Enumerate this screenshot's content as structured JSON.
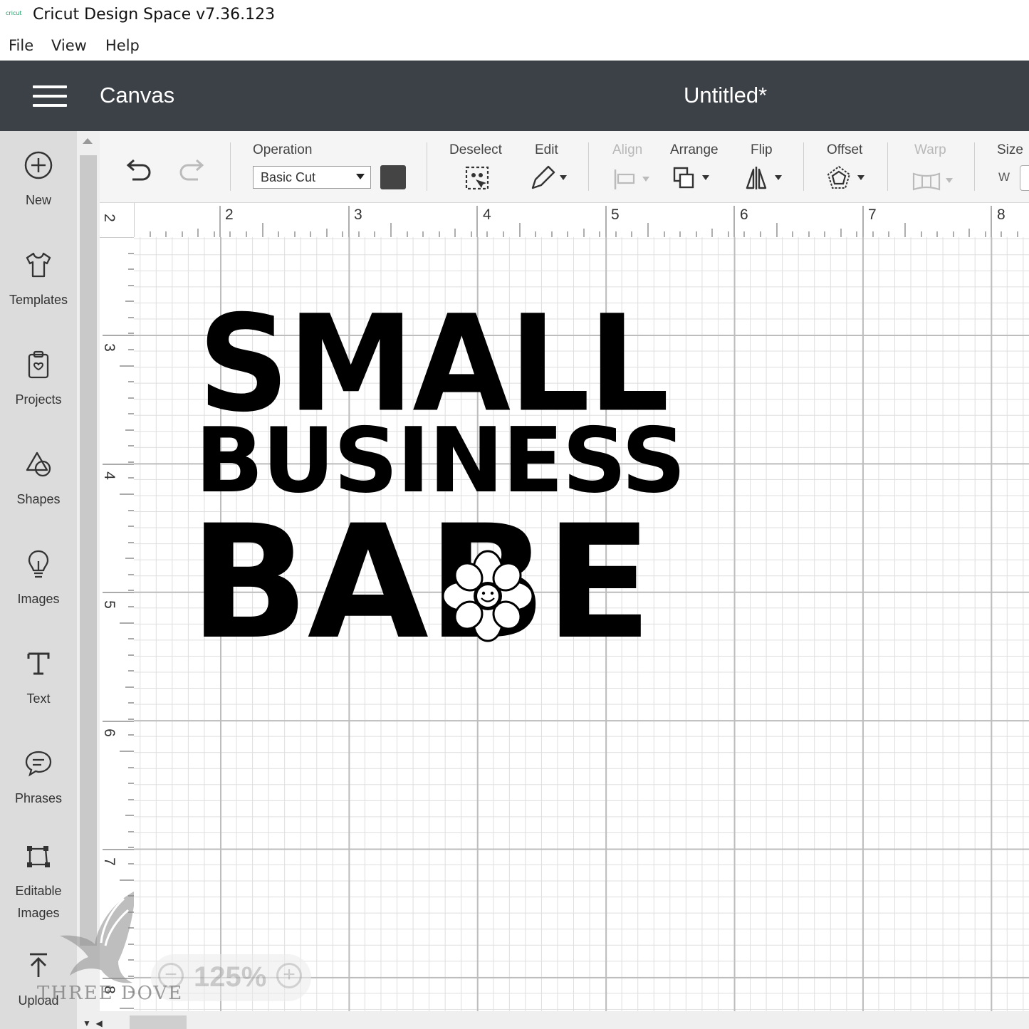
{
  "window": {
    "logo_text": "cricut",
    "title": "Cricut Design Space  v7.36.123"
  },
  "menu": [
    "File",
    "View",
    "Help"
  ],
  "header": {
    "section": "Canvas",
    "document": "Untitled*"
  },
  "sidebar": {
    "items": [
      {
        "label": "New",
        "icon": "plus-circle-icon"
      },
      {
        "label": "Templates",
        "icon": "tshirt-icon"
      },
      {
        "label": "Projects",
        "icon": "clipboard-icon"
      },
      {
        "label": "Shapes",
        "icon": "shapes-icon"
      },
      {
        "label": "Images",
        "icon": "lightbulb-icon"
      },
      {
        "label": "Text",
        "icon": "text-t-icon"
      },
      {
        "label": "Phrases",
        "icon": "speech-bubble-icon"
      },
      {
        "label": "Editable Images",
        "icon": "editable-image-icon"
      },
      {
        "label": "Upload",
        "icon": "upload-icon"
      }
    ]
  },
  "toolbar": {
    "operation_label": "Operation",
    "operation_value": "Basic Cut",
    "operation_color": "#444444",
    "deselect_label": "Deselect",
    "edit_label": "Edit",
    "align_label": "Align",
    "arrange_label": "Arrange",
    "flip_label": "Flip",
    "offset_label": "Offset",
    "warp_label": "Warp",
    "size_label": "Size",
    "size_w_label": "W"
  },
  "rulers": {
    "horizontal": [
      "2",
      "2",
      "3",
      "4",
      "5",
      "6",
      "7",
      "8"
    ],
    "vertical": [
      "3",
      "4",
      "5",
      "6",
      "7",
      "8"
    ]
  },
  "artwork": {
    "line1": "SMALL",
    "line2": "BUSINESS",
    "line3": "BABE"
  },
  "zoom": {
    "minus": "−",
    "value": "125%",
    "plus": "+"
  },
  "watermark": "THREE DOVE"
}
